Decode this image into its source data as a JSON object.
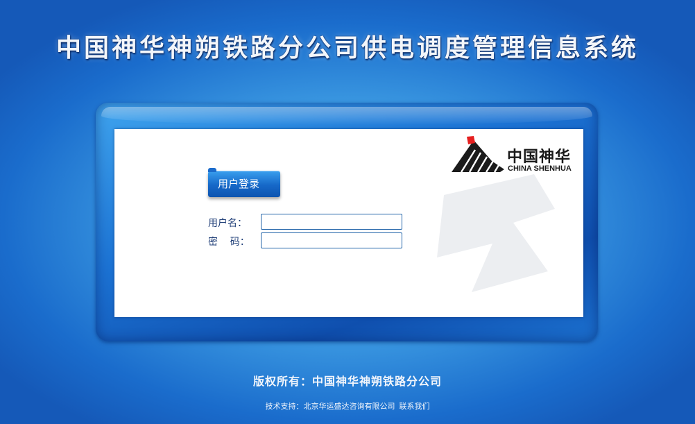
{
  "header": {
    "title": "中国神华神朔铁路分公司供电调度管理信息系统"
  },
  "logo": {
    "cn": "中国神华",
    "en": "CHINA SHENHUA",
    "mark_colors": {
      "slope": "#1b1b1b",
      "flag": "#e51f1f"
    }
  },
  "login": {
    "tab_label": "用户登录",
    "username_label": "用户名：",
    "username_value": "",
    "password_label": "密    码：",
    "password_value": ""
  },
  "footer": {
    "copyright": "版权所有：中国神华神朔铁路分公司",
    "support_text": "技术支持：北京华运盛达咨询有限公司",
    "contact_link": "联系我们"
  },
  "colors": {
    "background": "#3c9ae2",
    "frame": "#1c73d4",
    "tab": "#1668c8",
    "input_border": "#1f62a8",
    "label": "#1f3e77"
  }
}
